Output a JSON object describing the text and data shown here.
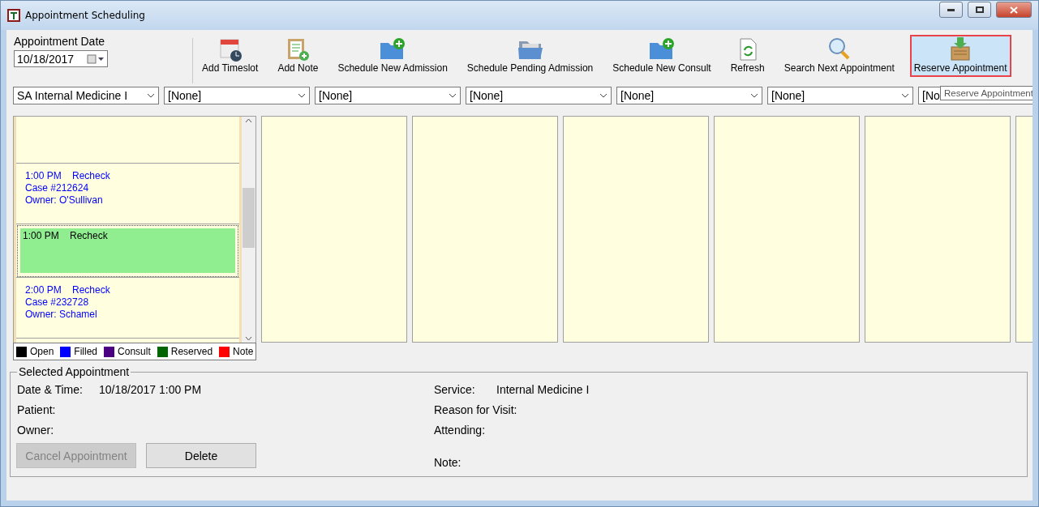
{
  "window": {
    "title": "Appointment Scheduling"
  },
  "date": {
    "label": "Appointment Date",
    "value": "10/18/2017"
  },
  "toolbar": [
    {
      "kind": "timeslot",
      "label": "Add Timeslot",
      "highlighted": false
    },
    {
      "kind": "note",
      "label": "Add Note",
      "highlighted": false
    },
    {
      "kind": "admission",
      "label": "Schedule New Admission",
      "highlighted": false
    },
    {
      "kind": "pending",
      "label": "Schedule Pending Admission",
      "highlighted": false
    },
    {
      "kind": "consult",
      "label": "Schedule New Consult",
      "highlighted": false
    },
    {
      "kind": "refresh",
      "label": "Refresh",
      "highlighted": false
    },
    {
      "kind": "search",
      "label": "Search Next Appointment",
      "highlighted": false
    },
    {
      "kind": "reserve",
      "label": "Reserve Appointment",
      "highlighted": true
    }
  ],
  "tooltip": "Reserve Appointment",
  "service_selects": [
    "SA Internal Medicine I",
    "[None]",
    "[None]",
    "[None]",
    "[None]",
    "[None]",
    "[No"
  ],
  "slots": [
    {
      "kind": "filled",
      "selected": false,
      "time": "1:00 PM",
      "reason": "Recheck",
      "lines": [
        "Case #212624",
        "Owner: O'Sullivan"
      ]
    },
    {
      "kind": "reserved",
      "selected": true,
      "time": "1:00 PM",
      "reason": "Recheck"
    },
    {
      "kind": "filled",
      "selected": false,
      "time": "2:00 PM",
      "reason": "Recheck",
      "lines": [
        "Case #232728",
        "Owner: Schamel"
      ]
    }
  ],
  "legend": [
    {
      "label": "Open",
      "color": "#000000"
    },
    {
      "label": "Filled",
      "color": "#0000ff"
    },
    {
      "label": "Consult",
      "color": "#4b0082"
    },
    {
      "label": "Reserved",
      "color": "#006400"
    },
    {
      "label": "Note",
      "color": "#ff0000"
    }
  ],
  "selected_appointment": {
    "title": "Selected Appointment",
    "left": [
      {
        "label": "Date & Time:",
        "value": "10/18/2017 1:00 PM"
      },
      {
        "label": "Patient:"
      },
      {
        "label": "Owner:"
      }
    ],
    "right": [
      {
        "label": "Service:",
        "value": "Internal Medicine I"
      },
      {
        "label": "Reason for Visit:"
      },
      {
        "label": "Attending:"
      },
      {
        "label": "Note:"
      }
    ],
    "buttons": [
      {
        "label": "Cancel Appointment",
        "disabled": true
      },
      {
        "label": "Delete",
        "disabled": false
      }
    ]
  }
}
